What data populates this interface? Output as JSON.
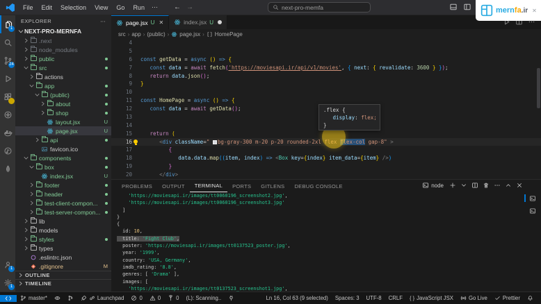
{
  "titlebar": {
    "menus": [
      "File",
      "Edit",
      "Selection",
      "View",
      "Go",
      "Run"
    ],
    "overflow": "⋯",
    "back": "←",
    "forward": "→",
    "search_value": "next-pro-memfa"
  },
  "logo": {
    "mern": "mern",
    "fa": "fa",
    "ir": ".ir",
    "close": "✕"
  },
  "activity": {
    "items": [
      {
        "n": "explorer",
        "ic": "files",
        "badge": "1",
        "active": true
      },
      {
        "n": "search",
        "ic": "search"
      },
      {
        "n": "source-control",
        "ic": "branch",
        "badge": "24"
      },
      {
        "n": "run-and-debug",
        "ic": "debug"
      },
      {
        "n": "extensions",
        "ic": "extensions",
        "badge": "",
        "badge_color": "yellow"
      },
      {
        "n": "remote-explorer",
        "ic": "circlegear"
      },
      {
        "n": "docker",
        "ic": "docker"
      },
      {
        "n": "live-share",
        "ic": "circlenote"
      },
      {
        "n": "mongodb",
        "ic": "leaf"
      }
    ],
    "bottom": [
      {
        "n": "accounts",
        "ic": "account",
        "badge": "1"
      },
      {
        "n": "settings",
        "ic": "gear",
        "badge": "1"
      }
    ]
  },
  "explorer": {
    "title": "EXPLORER",
    "actions": "⋯",
    "root": "NEXT-PRO-MERNFA",
    "tree": [
      {
        "i": 1,
        "c": "r",
        "ic": "folder",
        "l": ".next",
        "col": "dim"
      },
      {
        "i": 1,
        "c": "r",
        "ic": "folder",
        "l": "node_modules",
        "col": "dim"
      },
      {
        "i": 1,
        "c": "r",
        "ic": "folder",
        "l": "public",
        "col": "green",
        "b": "dot"
      },
      {
        "i": 1,
        "c": "d",
        "ic": "folder",
        "l": "src",
        "col": "green",
        "b": "dot"
      },
      {
        "i": 2,
        "c": "r",
        "ic": "folder",
        "l": "actions",
        "col": "norm"
      },
      {
        "i": 2,
        "c": "d",
        "ic": "folder",
        "l": "app",
        "col": "green",
        "b": "dot"
      },
      {
        "i": 3,
        "c": "d",
        "ic": "folder",
        "l": "(public)",
        "col": "green",
        "b": "dot"
      },
      {
        "i": 4,
        "c": "r",
        "ic": "folder",
        "l": "about",
        "col": "green",
        "b": "dot"
      },
      {
        "i": 4,
        "c": "r",
        "ic": "folder",
        "l": "shop",
        "col": "green",
        "b": "dot"
      },
      {
        "i": 4,
        "c": "n",
        "ic": "react",
        "l": "layout.jsx",
        "col": "green",
        "b": "U"
      },
      {
        "i": 4,
        "c": "n",
        "ic": "react",
        "l": "page.jsx",
        "col": "green",
        "b": "U",
        "sel": true
      },
      {
        "i": 3,
        "c": "r",
        "ic": "folder",
        "l": "api",
        "col": "green",
        "b": "dot"
      },
      {
        "i": 3,
        "c": "n",
        "ic": "img",
        "l": "favicon.ico",
        "col": "norm"
      },
      {
        "i": 1,
        "c": "d",
        "ic": "folder",
        "l": "components",
        "col": "green",
        "b": "dot"
      },
      {
        "i": 2,
        "c": "d",
        "ic": "folder",
        "l": "box",
        "col": "green",
        "b": "dot"
      },
      {
        "i": 3,
        "c": "n",
        "ic": "react",
        "l": "index.jsx",
        "col": "green",
        "b": "U"
      },
      {
        "i": 2,
        "c": "r",
        "ic": "folder",
        "l": "footer",
        "col": "green",
        "b": "dot"
      },
      {
        "i": 2,
        "c": "r",
        "ic": "folder",
        "l": "header",
        "col": "green",
        "b": "dot"
      },
      {
        "i": 2,
        "c": "r",
        "ic": "folder",
        "l": "test-client-compon...",
        "col": "green",
        "b": "dot"
      },
      {
        "i": 2,
        "c": "r",
        "ic": "folder",
        "l": "test-server-compon...",
        "col": "green",
        "b": "dot"
      },
      {
        "i": 1,
        "c": "r",
        "ic": "folder",
        "l": "lib",
        "col": "norm"
      },
      {
        "i": 1,
        "c": "r",
        "ic": "folder",
        "l": "models",
        "col": "norm"
      },
      {
        "i": 1,
        "c": "r",
        "ic": "folder",
        "l": "styles",
        "col": "green",
        "b": "dot"
      },
      {
        "i": 1,
        "c": "r",
        "ic": "folder",
        "l": "types",
        "col": "norm"
      },
      {
        "i": 1,
        "c": "n",
        "ic": "eslint",
        "l": ".eslintrc.json",
        "col": "norm"
      },
      {
        "i": 1,
        "c": "n",
        "ic": "git",
        "l": ".gitignore",
        "col": "orange",
        "b": "M"
      }
    ],
    "sections": [
      "OUTLINE",
      "TIMELINE"
    ]
  },
  "editor": {
    "tabs": [
      {
        "label": "page.jsx",
        "git": "U",
        "active": true,
        "close": "✕"
      },
      {
        "label": "index.jsx",
        "git": "U",
        "dirty": true
      }
    ],
    "breadcrumb": [
      {
        "label": "src"
      },
      {
        "label": "app"
      },
      {
        "label": "(public)"
      },
      {
        "label": "page.jsx",
        "icon": "react"
      },
      {
        "label": "HomePage",
        "icon": "symbol"
      }
    ],
    "lines": [
      {
        "n": "4",
        "tokens": []
      },
      {
        "n": "5",
        "tokens": []
      },
      {
        "n": "6",
        "tokens": [
          [
            "kw",
            "const"
          ],
          [
            "pw",
            " "
          ],
          [
            "fn",
            "getData"
          ],
          [
            "pw",
            " = "
          ],
          [
            "kw",
            "async"
          ],
          [
            "pw",
            " "
          ],
          [
            "pg",
            "()"
          ],
          [
            "pw",
            " "
          ],
          [
            "kw",
            "=>"
          ],
          [
            "pw",
            " "
          ],
          [
            "pg",
            "{"
          ]
        ]
      },
      {
        "n": "7",
        "tokens": [
          [
            "pw",
            "   "
          ],
          [
            "kw",
            "const"
          ],
          [
            "pw",
            " "
          ],
          [
            "vr",
            "data"
          ],
          [
            "pw",
            " = "
          ],
          [
            "ctl",
            "await"
          ],
          [
            "pw",
            " "
          ],
          [
            "fn",
            "fetch"
          ],
          [
            "pp",
            "("
          ],
          [
            "lnk",
            "'https://moviesapi.ir/api/v1/movies'"
          ],
          [
            "pw",
            ", "
          ],
          [
            "pb",
            "{"
          ],
          [
            "pw",
            " "
          ],
          [
            "vr",
            "next"
          ],
          [
            "pw",
            ": "
          ],
          [
            "pg",
            "{"
          ],
          [
            "pw",
            " "
          ],
          [
            "vr",
            "revalidate"
          ],
          [
            "pw",
            ": "
          ],
          [
            "nm",
            "3600"
          ],
          [
            "pw",
            " "
          ],
          [
            "pg",
            "}"
          ],
          [
            "pw",
            " "
          ],
          [
            "pb",
            "}"
          ],
          [
            "pp",
            ")"
          ],
          [
            "pw",
            ";"
          ]
        ]
      },
      {
        "n": "8",
        "tokens": [
          [
            "pw",
            "   "
          ],
          [
            "ctl",
            "return"
          ],
          [
            "pw",
            " "
          ],
          [
            "vr",
            "data"
          ],
          [
            "pw",
            "."
          ],
          [
            "fn",
            "json"
          ],
          [
            "pp",
            "()"
          ],
          [
            "pw",
            ";"
          ]
        ]
      },
      {
        "n": "9",
        "tokens": [
          [
            "pg",
            "}"
          ]
        ]
      },
      {
        "n": "10",
        "tokens": []
      },
      {
        "n": "11",
        "tokens": [
          [
            "kw",
            "const"
          ],
          [
            "pw",
            " "
          ],
          [
            "fn",
            "HomePage"
          ],
          [
            "pw",
            " = "
          ],
          [
            "kw",
            "async"
          ],
          [
            "pw",
            " "
          ],
          [
            "pg",
            "()"
          ],
          [
            "pw",
            " "
          ],
          [
            "kw",
            "=>"
          ],
          [
            "pw",
            " "
          ],
          [
            "pg",
            "{"
          ]
        ]
      },
      {
        "n": "12",
        "tokens": [
          [
            "pw",
            "   "
          ],
          [
            "kw",
            "const"
          ],
          [
            "pw",
            " "
          ],
          [
            "vr",
            "data"
          ],
          [
            "pw",
            " = "
          ],
          [
            "ctl",
            "await"
          ],
          [
            "pw",
            " "
          ],
          [
            "fn",
            "getData"
          ],
          [
            "pp",
            "()"
          ],
          [
            "pw",
            ";"
          ]
        ]
      },
      {
        "n": "13",
        "tokens": []
      },
      {
        "n": "14",
        "tokens": []
      },
      {
        "n": "15",
        "tokens": [
          [
            "pw",
            "   "
          ],
          [
            "ctl",
            "return"
          ],
          [
            "pw",
            " "
          ],
          [
            "pg",
            "("
          ]
        ]
      },
      {
        "n": "16",
        "current": true,
        "bulb": true,
        "tokens": [
          [
            "pw",
            "      "
          ],
          [
            "ag",
            "<"
          ],
          [
            "tg",
            "div"
          ],
          [
            "pw",
            " "
          ],
          [
            "vr",
            "className"
          ],
          [
            "pw",
            "="
          ],
          [
            "st",
            "\" "
          ],
          [
            "swatch",
            ""
          ],
          [
            "st",
            "bg-gray-300 m-20 p-20 rounded-2xl flex "
          ],
          [
            "stsel",
            "flex-col"
          ],
          [
            "st",
            " gap-8\""
          ],
          [
            "pw",
            " "
          ],
          [
            "ag",
            ">"
          ]
        ]
      },
      {
        "n": "17",
        "tokens": [
          [
            "pw",
            "         "
          ],
          [
            "pp",
            "{"
          ]
        ]
      },
      {
        "n": "18",
        "tokens": [
          [
            "pw",
            "            "
          ],
          [
            "vr",
            "data"
          ],
          [
            "pw",
            "."
          ],
          [
            "vr",
            "data"
          ],
          [
            "pw",
            "."
          ],
          [
            "fn",
            "map"
          ],
          [
            "pb",
            "(("
          ],
          [
            "vr",
            "item"
          ],
          [
            "pw",
            ", "
          ],
          [
            "vr",
            "index"
          ],
          [
            "pb",
            ")"
          ],
          [
            "pw",
            " "
          ],
          [
            "kw",
            "=>"
          ],
          [
            "pw",
            " "
          ],
          [
            "ag",
            "<"
          ],
          [
            "cp",
            "Box"
          ],
          [
            "pw",
            " "
          ],
          [
            "vr",
            "key"
          ],
          [
            "pw",
            "="
          ],
          [
            "pg",
            "{"
          ],
          [
            "vr",
            "index"
          ],
          [
            "pg",
            "}"
          ],
          [
            "pw",
            " "
          ],
          [
            "vr",
            "item_data"
          ],
          [
            "pw",
            "="
          ],
          [
            "pg",
            "{"
          ],
          [
            "vr",
            "item"
          ],
          [
            "pg",
            "}"
          ],
          [
            "pw",
            " "
          ],
          [
            "ag",
            "/>"
          ],
          [
            "pb",
            ")"
          ]
        ]
      },
      {
        "n": "19",
        "tokens": [
          [
            "pw",
            "         "
          ],
          [
            "pp",
            "}"
          ]
        ]
      },
      {
        "n": "20",
        "tokens": [
          [
            "pw",
            "      "
          ],
          [
            "ag",
            "</"
          ],
          [
            "tg",
            "div"
          ],
          [
            "ag",
            ">"
          ]
        ]
      }
    ],
    "tooltip": [
      [
        [
          "pw",
          ".flex {"
        ]
      ],
      [
        [
          "pw",
          "   "
        ],
        [
          "vr",
          "display"
        ],
        [
          "pw",
          ": "
        ],
        [
          "st",
          "flex;"
        ]
      ],
      [
        [
          "pw",
          "}"
        ]
      ]
    ]
  },
  "panel": {
    "tabs": [
      "PROBLEMS",
      "OUTPUT",
      "TERMINAL",
      "PORTS",
      "GITLENS",
      "DEBUG CONSOLE"
    ],
    "active_tab": "TERMINAL",
    "shell": "node",
    "lines": [
      {
        "tokens": [
          [
            "w",
            "    "
          ],
          [
            "g",
            "'https://moviesapi.ir/images/tt0060196_screenshot2.jpg'"
          ],
          [
            "w",
            ","
          ]
        ]
      },
      {
        "tokens": [
          [
            "w",
            "    "
          ],
          [
            "g",
            "'https://moviesapi.ir/images/tt0060196_screenshot3.jpg'"
          ]
        ]
      },
      {
        "tokens": [
          [
            "w",
            "  ]"
          ]
        ]
      },
      {
        "tokens": [
          [
            "w",
            "}"
          ]
        ]
      },
      {
        "tokens": [
          [
            "w",
            "{"
          ]
        ]
      },
      {
        "tokens": [
          [
            "w",
            "  id: "
          ],
          [
            "y",
            "10"
          ],
          [
            "w",
            ","
          ]
        ]
      },
      {
        "selected": true,
        "tokens": [
          [
            "w",
            "  title: "
          ],
          [
            "g",
            "'Fight Club'"
          ],
          [
            "w",
            ","
          ]
        ]
      },
      {
        "tokens": [
          [
            "w",
            "  poster: "
          ],
          [
            "g",
            "'https://moviesapi.ir/images/tt0137523_poster.jpg'"
          ],
          [
            "w",
            ","
          ]
        ]
      },
      {
        "tokens": [
          [
            "w",
            "  year: "
          ],
          [
            "g",
            "'1999'"
          ],
          [
            "w",
            ","
          ]
        ]
      },
      {
        "tokens": [
          [
            "w",
            "  country: "
          ],
          [
            "g",
            "'USA, Germany'"
          ],
          [
            "w",
            ","
          ]
        ]
      },
      {
        "tokens": [
          [
            "w",
            "  imdb_rating: "
          ],
          [
            "g",
            "'8.8'"
          ],
          [
            "w",
            ","
          ]
        ]
      },
      {
        "tokens": [
          [
            "w",
            "  genres: [ "
          ],
          [
            "g",
            "'Drama'"
          ],
          [
            "w",
            " ],"
          ]
        ]
      },
      {
        "tokens": [
          [
            "w",
            "  images: ["
          ]
        ]
      },
      {
        "tokens": [
          [
            "w",
            "    "
          ],
          [
            "g",
            "'https://moviesapi.ir/images/tt0137523_screenshot1.jpg'"
          ],
          [
            "w",
            ","
          ]
        ]
      }
    ]
  },
  "status": {
    "left": [
      {
        "n": "remote-indicator",
        "ic": "remote",
        "chip": true
      },
      {
        "n": "git-branch",
        "ic": "branch",
        "l": "master*"
      },
      {
        "n": "gitlens-toggle",
        "ic": "eye"
      },
      {
        "n": "commit-graph",
        "ic": "graph"
      },
      {
        "n": "launchpad",
        "ic": "rocket",
        "ic2": "link",
        "l": "Launchpad"
      },
      {
        "n": "errors",
        "ic": "error",
        "l": "0"
      },
      {
        "n": "warnings",
        "ic": "warn",
        "l": "0"
      },
      {
        "n": "ports",
        "ic": "antenna",
        "l": "0"
      },
      {
        "n": "scanner-status",
        "l": "(L): Scanning.."
      },
      {
        "n": "power-status",
        "ic": "plug"
      }
    ],
    "right": [
      {
        "n": "cursor-position",
        "l": "Ln 16, Col 63 (9 selected)"
      },
      {
        "n": "indentation",
        "l": "Spaces: 3"
      },
      {
        "n": "encoding",
        "l": "UTF-8"
      },
      {
        "n": "eol",
        "l": "CRLF"
      },
      {
        "n": "language-mode",
        "ic": "braces",
        "l": "JavaScript JSX"
      },
      {
        "n": "go-live",
        "ic": "broadcast",
        "l": "Go Live"
      },
      {
        "n": "prettier",
        "ic": "check",
        "l": "Prettier"
      },
      {
        "n": "notifications",
        "ic": "bell"
      }
    ]
  }
}
